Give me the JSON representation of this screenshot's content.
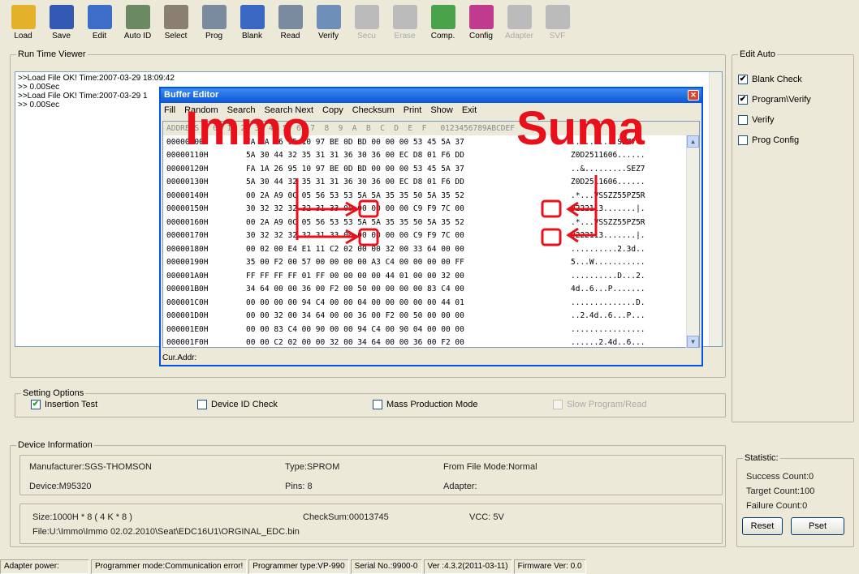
{
  "toolbar": {
    "buttons": [
      {
        "label": "Load",
        "icon": "load-icon",
        "disabled": false,
        "color": "#e4b22a"
      },
      {
        "label": "Save",
        "icon": "save-icon",
        "disabled": false,
        "color": "#3359b5"
      },
      {
        "label": "Edit",
        "icon": "edit-icon",
        "disabled": false,
        "color": "#3e6cc9"
      },
      {
        "label": "Auto ID",
        "icon": "auto-id-icon",
        "disabled": false,
        "color": "#6b8a63"
      },
      {
        "label": "Select",
        "icon": "select-icon",
        "disabled": false,
        "color": "#8a7f70"
      },
      {
        "label": "Prog",
        "icon": "prog-icon",
        "disabled": false,
        "color": "#7a8ba0"
      },
      {
        "label": "Blank",
        "icon": "blank-icon",
        "disabled": false,
        "color": "#3a67c2"
      },
      {
        "label": "Read",
        "icon": "read-icon",
        "disabled": false,
        "color": "#7a8ba0"
      },
      {
        "label": "Verify",
        "icon": "verify-icon",
        "disabled": false,
        "color": "#6d8fb8"
      },
      {
        "label": "Secu",
        "icon": "secu-icon",
        "disabled": true,
        "color": "#bbbbbb"
      },
      {
        "label": "Erase",
        "icon": "erase-icon",
        "disabled": true,
        "color": "#bbbbbb"
      },
      {
        "label": "Comp.",
        "icon": "comp-icon",
        "disabled": false,
        "color": "#48a34a"
      },
      {
        "label": "Config",
        "icon": "config-icon",
        "disabled": false,
        "color": "#c03a8e"
      },
      {
        "label": "Adapter",
        "icon": "adapter-icon",
        "disabled": true,
        "color": "#bbbbbb"
      },
      {
        "label": "SVF",
        "icon": "svf-icon",
        "disabled": true,
        "color": "#bbbbbb"
      }
    ]
  },
  "runtime": {
    "title": "Run Time Viewer",
    "lines": [
      ">>Load File OK! Time:2007-03-29 18:09:42",
      ">> 0.00Sec",
      ">>Load File OK! Time:2007-03-29 1",
      ">> 0.00Sec"
    ]
  },
  "buffer_editor": {
    "title": "Buffer Editor",
    "menu": [
      "Fill",
      "Random",
      "Search",
      "Search Next",
      "Copy",
      "Checksum",
      "Print",
      "Show",
      "Exit"
    ],
    "header": "ADDRESS   0  1  2  3  4  5  6  7  8  9  A  B  C  D  E  F   0123456789ABCDEF",
    "rows": [
      {
        "addr": "00000100H",
        "hex": "FA 1A 26 95 10 97 BE 0D BD 00 00 00 53 45 5A 37",
        "ascii": "..&.......SEZ7"
      },
      {
        "addr": "00000110H",
        "hex": "5A 30 44 32 35 31 31 36 30 36 00 EC D8 01 F6 DD",
        "ascii": "Z0D2511606......"
      },
      {
        "addr": "00000120H",
        "hex": "FA 1A 26 95 10 97 BE 0D BD 00 00 00 53 45 5A 37",
        "ascii": "..&.........SEZ7"
      },
      {
        "addr": "00000130H",
        "hex": "5A 30 44 32 35 31 31 36 30 36 00 EC D8 01 F6 DD",
        "ascii": "Z0D2511606......"
      },
      {
        "addr": "00000140H",
        "hex": "00 2A A9 0C 05 56 53 53 5A 5A 35 35 50 5A 35 52",
        "ascii": ".*...VSSZZ55PZ5R"
      },
      {
        "addr": "00000150H",
        "hex": "30 32 32 32 32 31 33 00 00 00 00 00 C9 F9 7C 00",
        "ascii": "0222113.......|."
      },
      {
        "addr": "00000160H",
        "hex": "00 2A A9 0C 05 56 53 53 5A 5A 35 35 50 5A 35 52",
        "ascii": ".*...VSSZZ55PZ5R"
      },
      {
        "addr": "00000170H",
        "hex": "30 32 32 32 32 31 33 00 00 00 00 00 C9 F9 7C 00",
        "ascii": "0222113.......|."
      },
      {
        "addr": "00000180H",
        "hex": "00 02 00 E4 E1 11 C2 02 00 00 32 00 33 64 00 00",
        "ascii": "..........2.3d.."
      },
      {
        "addr": "00000190H",
        "hex": "35 00 F2 00 57 00 00 00 00 A3 C4 00 00 00 00 FF",
        "ascii": "5...W..........."
      },
      {
        "addr": "000001A0H",
        "hex": "FF FF FF FF 01 FF 00 00 00 00 44 01 00 00 32 00",
        "ascii": "..........D...2."
      },
      {
        "addr": "000001B0H",
        "hex": "34 64 00 00 36 00 F2 00 50 00 00 00 00 83 C4 00",
        "ascii": "4d..6...P......."
      },
      {
        "addr": "000001C0H",
        "hex": "00 00 00 00 94 C4 00 00 04 00 00 00 00 00 44 01",
        "ascii": "..............D."
      },
      {
        "addr": "000001D0H",
        "hex": "00 00 32 00 34 64 00 00 36 00 F2 00 50 00 00 00",
        "ascii": "..2.4d..6...P..."
      },
      {
        "addr": "000001E0H",
        "hex": "00 00 83 C4 00 90 00 00 94 C4 00 90 04 00 00 00",
        "ascii": "................"
      },
      {
        "addr": "000001F0H",
        "hex": "00 00 C2 02 00 00 32 00 34 64 00 00 36 00 F2 00",
        "ascii": "......2.4d..6..."
      }
    ],
    "cur_addr_label": "Cur.Addr:"
  },
  "watermark": {
    "left": "Immo",
    "right": "Suma",
    "color": "#e8101a"
  },
  "edit_auto": {
    "title": "Edit Auto",
    "options": [
      {
        "label": "Blank Check",
        "checked": true
      },
      {
        "label": "Program\\Verify",
        "checked": true
      },
      {
        "label": "Verify",
        "checked": false
      },
      {
        "label": "Prog Config",
        "checked": false
      }
    ]
  },
  "settings": {
    "title": "Setting Options",
    "insertion_test": "Insertion Test",
    "device_id_check": "Device ID Check",
    "mass_production": "Mass Production Mode",
    "slow_program": "Slow Program/Read"
  },
  "device_info": {
    "title": "Device Information",
    "manufacturer": "Manufacturer:SGS-THOMSON",
    "type": "Type:SPROM",
    "from_file_mode": "From File Mode:Normal",
    "device": "Device:M95320",
    "pins": "Pins: 8",
    "adapter": "Adapter:",
    "size": "Size:1000H * 8 ( 4 K * 8 )",
    "checksum": "CheckSum:00013745",
    "vcc": "VCC: 5V",
    "file": "File:U:\\Immo\\Immo 02.02.2010\\Seat\\EDC16U1\\ORGINAL_EDC.bin"
  },
  "statistic": {
    "title": "Statistic:",
    "success": "Success Count:0",
    "target": "Target Count:100",
    "failure": "Failure Count:0",
    "reset": "Reset",
    "pset": "Pset"
  },
  "statusbar": {
    "adapter_power": "Adapter power:",
    "programmer_mode": "Programmer mode:Communication error!",
    "programmer_type": "Programmer type:VP-990",
    "serial": "Serial No.:9900-0",
    "ver": "Ver :4.3.2(2011-03-11)",
    "firmware": "Firmware Ver: 0.0"
  }
}
